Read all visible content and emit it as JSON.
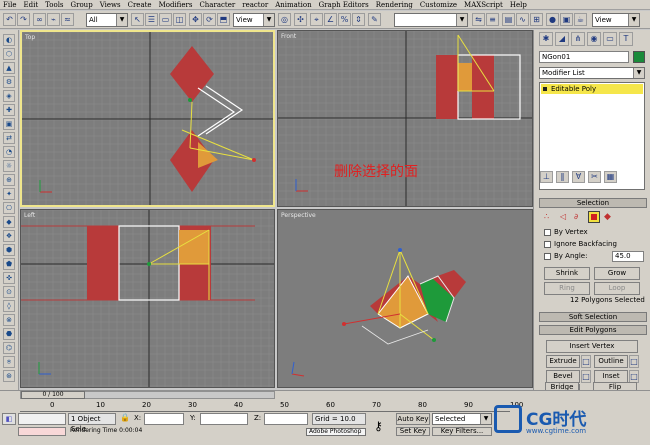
{
  "menu": [
    "File",
    "Edit",
    "Tools",
    "Group",
    "Views",
    "Create",
    "Modifiers",
    "Character",
    "reactor",
    "Animation",
    "Graph Editors",
    "Rendering",
    "Customize",
    "MAXScript",
    "Help"
  ],
  "toolbar": {
    "selection_filter": "All",
    "ref_coord": "View",
    "named_sel": "View"
  },
  "viewports": {
    "top": "Top",
    "front": "Front",
    "left": "Left",
    "perspective": "Perspective"
  },
  "annotation": "删除选择的面",
  "command_panel": {
    "object_name": "NGon01",
    "object_color": "#1a8a3a",
    "modifier_list": "Modifier List",
    "stack_item": "Editable Poly",
    "selection_title": "Selection",
    "by_vertex": "By Vertex",
    "ignore_backfacing": "Ignore Backfacing",
    "by_angle": "By Angle:",
    "angle_value": "45.0",
    "shrink": "Shrink",
    "grow": "Grow",
    "ring": "Ring",
    "loop": "Loop",
    "status": "12 Polygons Selected",
    "soft_selection": "Soft Selection",
    "edit_polygons": "Edit Polygons",
    "insert_vertex": "Insert Vertex",
    "extrude": "Extrude",
    "outline": "Outline",
    "bevel": "Bevel",
    "inset": "Inset",
    "bridge": "Bridge",
    "flip": "Flip"
  },
  "timeline": {
    "slider": "0 / 100",
    "ticks": [
      "0",
      "10",
      "20",
      "30",
      "40",
      "50",
      "60",
      "70",
      "80",
      "90",
      "100"
    ]
  },
  "status_bar": {
    "object_sel": "1 Object Sele",
    "x_label": "X:",
    "y_label": "Y:",
    "z_label": "Z:",
    "grid": "Grid = 10.0",
    "render_time": "Rendering Time  0:00:04",
    "taskbar": "Adobe Photoshop",
    "auto_key": "Auto Key",
    "set_key": "Set Key",
    "selected": "Selected",
    "key_filters": "Key Filters...",
    "watermark": "CG时代",
    "watermark_url": "www.cgtime.com"
  },
  "colors": {
    "viewport_bg": "#7d7d7d",
    "active_border": "#f0e68c",
    "face_red": "#b83a3a",
    "face_orange": "#e09a3a",
    "face_green": "#1e9a3a"
  }
}
